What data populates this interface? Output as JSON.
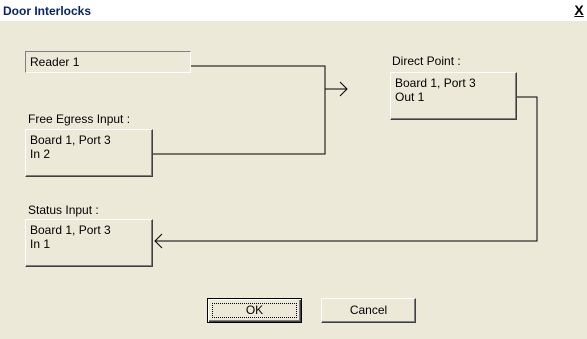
{
  "window": {
    "title": "Door Interlocks",
    "close_label": "X"
  },
  "reader": {
    "value": "Reader 1"
  },
  "direct_point": {
    "label": "Direct Point :",
    "line1": "Board 1, Port 3",
    "line2": "Out 1"
  },
  "free_egress": {
    "label": "Free Egress Input :",
    "line1": "Board 1, Port 3",
    "line2": "In 2"
  },
  "status_input": {
    "label": "Status Input :",
    "line1": "Board 1, Port 3",
    "line2": "In 1"
  },
  "buttons": {
    "ok": "OK",
    "cancel": "Cancel"
  }
}
